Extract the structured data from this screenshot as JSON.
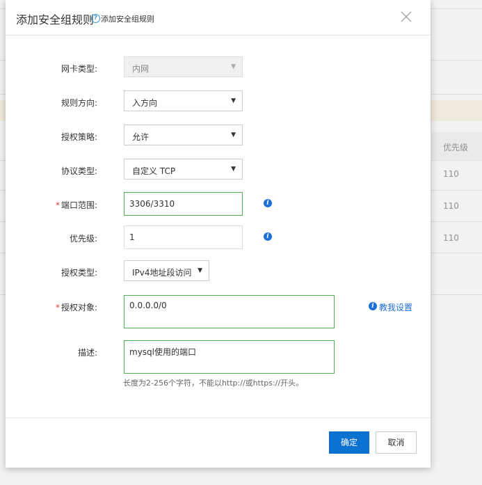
{
  "background": {
    "column_header": "优先级",
    "priorities": [
      "110",
      "110",
      "110"
    ]
  },
  "dialog": {
    "title": "添加安全组规则",
    "subtitle": "添加安全组规则",
    "help_icon": "question-circle-icon",
    "close_icon": "close-x-icon"
  },
  "form": {
    "nic_type": {
      "label": "网卡类型:",
      "value": "内网"
    },
    "direction": {
      "label": "规则方向:",
      "value": "入方向"
    },
    "policy": {
      "label": "授权策略:",
      "value": "允许"
    },
    "protocol": {
      "label": "协议类型:",
      "value": "自定义 TCP"
    },
    "port_range": {
      "label": "端口范围:",
      "value": "3306/3310",
      "required": "*"
    },
    "priority": {
      "label": "优先级:",
      "value": "1"
    },
    "auth_type": {
      "label": "授权类型:",
      "value": "IPv4地址段访问"
    },
    "auth_object": {
      "label": "授权对象:",
      "value": "0.0.0.0/0",
      "required": "*"
    },
    "teach_link": "教我设置",
    "description": {
      "label": "描述:",
      "value": "mysql使用的端口"
    },
    "hint": "长度为2-256个字符，不能以http://或https://开头。"
  },
  "footer": {
    "ok_label": "确定",
    "cancel_label": "取消"
  },
  "colors": {
    "primary": "#0b72d1",
    "valid_border": "#4caf50",
    "required": "#e4393c",
    "link": "#1e6fd9"
  }
}
